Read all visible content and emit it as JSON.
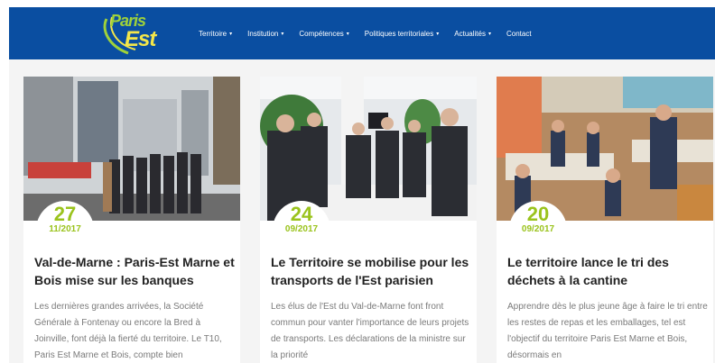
{
  "brand": {
    "logo_line1": "Paris",
    "logo_line2": "Est"
  },
  "nav": {
    "items": [
      {
        "label": "Territoire",
        "has_dropdown": true
      },
      {
        "label": "Institution",
        "has_dropdown": true
      },
      {
        "label": "Compétences",
        "has_dropdown": true
      },
      {
        "label": "Politiques territoriales",
        "has_dropdown": true
      },
      {
        "label": "Actualités",
        "has_dropdown": true
      },
      {
        "label": "Contact",
        "has_dropdown": false
      }
    ],
    "caret": "▾"
  },
  "colors": {
    "navbar": "#0a4ea1",
    "accent_green": "#9ac31c",
    "logo_yellow": "#f3e64a"
  },
  "articles": [
    {
      "day": "27",
      "month_year": "11/2017",
      "title": "Val-de-Marne : Paris-Est Marne et Bois mise sur les banques",
      "excerpt": "Les dernières grandes arrivées, la Société Générale à Fontenay ou encore la Bred à Joinville, font déjà la fierté du territoire. Le T10, Paris Est Marne et Bois, compte bien",
      "photo": "group-of-officials-on-street-photo"
    },
    {
      "day": "24",
      "month_year": "09/2017",
      "title": "Le Territoire se mobilise pour les transports de l'Est parisien",
      "excerpt": "Les élus de l'Est du Val-de-Marne font front commun pour vanter l'importance de leurs projets de transports. Les déclarations de la ministre sur la priorité",
      "photo": "officials-meeting-indoors-photo"
    },
    {
      "day": "20",
      "month_year": "09/2017",
      "title": "Le territoire lance le tri des déchets à la cantine",
      "excerpt": "Apprendre dès le plus jeune âge à faire le tri entre les restes de repas et les emballages, tel est l'objectif du territoire Paris Est Marne et Bois, désormais en",
      "photo": "school-cantine-photo"
    }
  ]
}
